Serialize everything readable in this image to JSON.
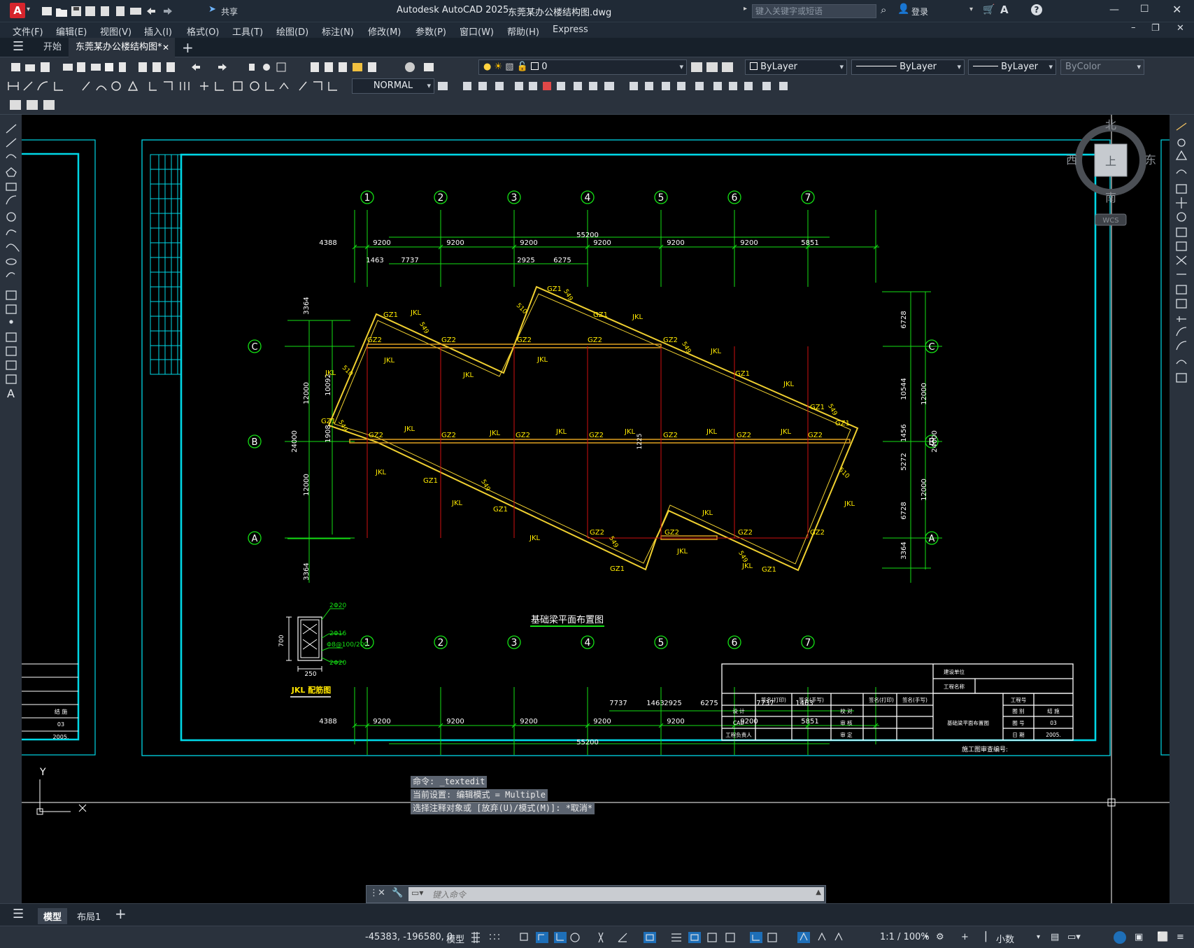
{
  "app": {
    "title": "Autodesk AutoCAD 2025",
    "file": "东莞某办公楼结构图.dwg",
    "share": "共享",
    "search_placeholder": "键入关键字或短语",
    "login": "登录"
  },
  "menus": [
    "文件(F)",
    "编辑(E)",
    "视图(V)",
    "插入(I)",
    "格式(O)",
    "工具(T)",
    "绘图(D)",
    "标注(N)",
    "修改(M)",
    "参数(P)",
    "窗口(W)",
    "帮助(H)",
    "Express"
  ],
  "tabs": {
    "start": "开始",
    "doc": "东莞某办公楼结构图*"
  },
  "toolbar": {
    "layer": "0",
    "color": "ByLayer",
    "linetype": "ByLayer",
    "lineweight": "ByLayer",
    "plotstyle": "ByColor",
    "dimstyle": "NORMAL"
  },
  "viewcube": {
    "n": "北",
    "s": "南",
    "e": "东",
    "w": "西",
    "top": "上",
    "wcs": "WCS"
  },
  "drawing": {
    "axes_top": [
      "1",
      "2",
      "3",
      "4",
      "5",
      "6",
      "7"
    ],
    "axes_side": [
      "C",
      "B",
      "A"
    ],
    "dims_top": [
      "4388",
      "9200",
      "9200",
      "9200",
      "9200",
      "9200",
      "9200",
      "5851"
    ],
    "total_width": "55200",
    "dims_top2": [
      "1463",
      "7737",
      "2925",
      "6275"
    ],
    "dims_bottom2": [
      "7737",
      "1463",
      "2925",
      "6275",
      "7737",
      "1463"
    ],
    "dims_left": [
      "3364",
      "12000",
      "12000",
      "3364"
    ],
    "dims_left2": [
      "10092",
      "1908"
    ],
    "total_height": "24000",
    "dims_right": [
      "6728",
      "10544",
      "1456",
      "5272",
      "6728",
      "3364"
    ],
    "dims_right2": [
      "12000",
      "12000"
    ],
    "labels": {
      "gz1": "GZ1",
      "gz2": "GZ2",
      "jkl": "JKL",
      "d549": "549",
      "d510": "510",
      "d1225": "1225"
    },
    "plan_title": "基础梁平面布置图",
    "section": {
      "title": "JKL 配筋图",
      "top": "2Φ20",
      "mid": "2Φ16",
      "stir": "Φ8@100/200",
      "bot": "2Φ20",
      "h": "700",
      "w": "250"
    },
    "titleblock": {
      "build_unit": "建设单位",
      "project": "工程名称",
      "sign_print": "签名(打印)",
      "sign_hand": "签名(手写)",
      "design": "设 计",
      "cad": "CAD",
      "lead": "工程负责人",
      "check": "校 对",
      "audit": "审 核",
      "approve": "审 定",
      "proj_no": "工程号",
      "drawing_name": "基础梁平面布置图",
      "category": "图 别",
      "struct": "结 施",
      "dwg_no": "图 号",
      "dwg_no_val": "03",
      "date": "日 期",
      "date_val": "2005.",
      "review_no": "施工图审查编号:"
    },
    "left_sheet": {
      "a": "结 施",
      "b": "03",
      "c": "2005."
    }
  },
  "command": {
    "lines": [
      "命令: _textedit",
      "当前设置: 编辑模式 = Multiple",
      "选择注释对象或 [放弃(U)/模式(M)]: *取消*"
    ],
    "placeholder": "键入命令"
  },
  "layout_tabs": [
    "模型",
    "布局1"
  ],
  "status": {
    "coords": "-45383, -196580, 0",
    "model": "模型",
    "scale": "1:1 / 100%",
    "units": "小数"
  }
}
